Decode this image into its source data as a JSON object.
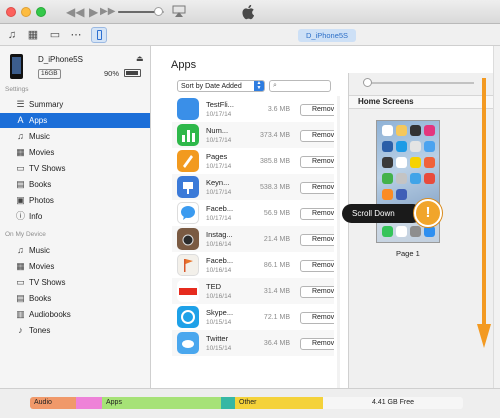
{
  "device": {
    "name": "D_iPhone5S",
    "capacity": "16GB",
    "battery_percent": "90%",
    "battery_level": 0.9
  },
  "navbar": {
    "device_pill": "D_iPhone5S"
  },
  "sidebar": {
    "settings_label": "Settings",
    "settings_items": [
      {
        "label": "Summary",
        "icon": "summary-icon"
      },
      {
        "label": "Apps",
        "icon": "apps-icon",
        "selected": true
      },
      {
        "label": "Music",
        "icon": "music-icon"
      },
      {
        "label": "Movies",
        "icon": "movies-icon"
      },
      {
        "label": "TV Shows",
        "icon": "tv-icon"
      },
      {
        "label": "Books",
        "icon": "books-icon"
      },
      {
        "label": "Photos",
        "icon": "photos-icon"
      },
      {
        "label": "Info",
        "icon": "info-icon"
      }
    ],
    "on_device_label": "On My Device",
    "device_items": [
      {
        "label": "Music",
        "icon": "music-icon"
      },
      {
        "label": "Movies",
        "icon": "movies-icon"
      },
      {
        "label": "TV Shows",
        "icon": "tv-icon"
      },
      {
        "label": "Books",
        "icon": "books-icon"
      },
      {
        "label": "Audiobooks",
        "icon": "audiobooks-icon"
      },
      {
        "label": "Tones",
        "icon": "tones-icon"
      }
    ]
  },
  "main": {
    "title": "Apps",
    "sort_label": "Sort by Date Added",
    "remove_label": "Remove",
    "apps": [
      {
        "name": "TestFli...",
        "date": "10/17/14",
        "size": "3.6 MB",
        "color": "#3a8fe8"
      },
      {
        "name": "Num...",
        "date": "10/17/14",
        "size": "373.4 MB",
        "color": "#2eb84a"
      },
      {
        "name": "Pages",
        "date": "10/17/14",
        "size": "385.8 MB",
        "color": "#f29a1f"
      },
      {
        "name": "Keyn...",
        "date": "10/17/14",
        "size": "538.3 MB",
        "color": "#3b7ad8"
      },
      {
        "name": "Faceb...",
        "date": "10/17/14",
        "size": "56.9 MB",
        "color": "#3b9bf0"
      },
      {
        "name": "Instag...",
        "date": "10/16/14",
        "size": "21.4 MB",
        "color": "#7a5a42"
      },
      {
        "name": "Faceb...",
        "date": "10/16/14",
        "size": "86.1 MB",
        "color": "#f3f0ea"
      },
      {
        "name": "TED",
        "date": "10/16/14",
        "size": "31.4 MB",
        "color": "#ffffff"
      },
      {
        "name": "Skype...",
        "date": "10/15/14",
        "size": "72.1 MB",
        "color": "#1ea1e8"
      },
      {
        "name": "Twitter",
        "date": "10/15/14",
        "size": "36.4 MB",
        "color": "#4aa7ee"
      }
    ]
  },
  "home": {
    "title": "Home Screens",
    "page_label": "Page 1"
  },
  "callout": {
    "text": "Scroll Down"
  },
  "storage": {
    "segments": [
      {
        "label": "Audio",
        "color": "#f0996a"
      },
      {
        "label": "",
        "color": "#ee82d8"
      },
      {
        "label": "Apps",
        "color": "#a6e277"
      },
      {
        "label": "",
        "color": "#36b7a4"
      },
      {
        "label": "Other",
        "color": "#f4d23a"
      },
      {
        "label": "4.41 GB Free",
        "color": "#f6f6f6"
      }
    ]
  }
}
